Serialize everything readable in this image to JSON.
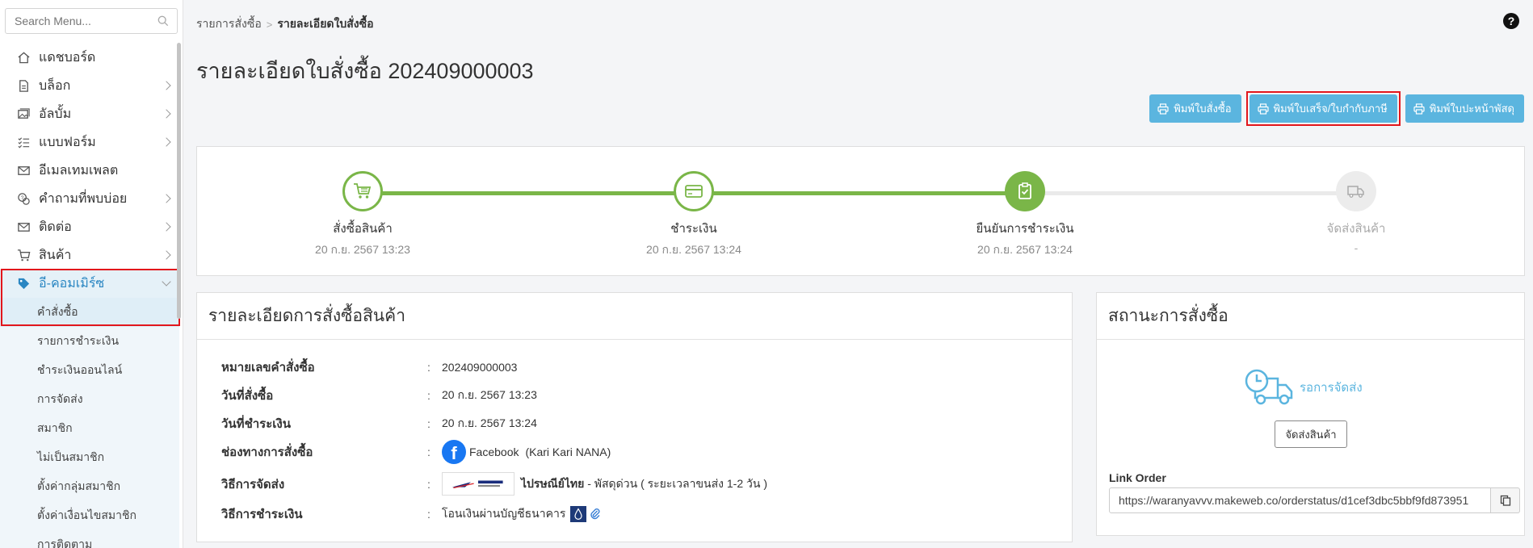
{
  "sidebar": {
    "search_placeholder": "Search Menu...",
    "items": [
      {
        "label": "แดชบอร์ด",
        "icon": "home-icon"
      },
      {
        "label": "บล็อก",
        "icon": "document-icon"
      },
      {
        "label": "อัลบั้ม",
        "icon": "album-icon"
      },
      {
        "label": "แบบฟอร์ม",
        "icon": "form-list-icon"
      },
      {
        "label": "อีเมลเทมเพลต",
        "icon": "envelope-icon"
      },
      {
        "label": "คำถามที่พบบ่อย",
        "icon": "faq-icon"
      },
      {
        "label": "ติดต่อ",
        "icon": "envelope-icon"
      },
      {
        "label": "สินค้า",
        "icon": "cart-icon"
      },
      {
        "label": "อี-คอมเมิร์ซ",
        "icon": "tag-icon"
      }
    ],
    "submenu": [
      "คำสั่งซื้อ",
      "รายการชำระเงิน",
      "ชำระเงินออนไลน์",
      "การจัดส่ง",
      "สมาชิก",
      "ไม่เป็นสมาชิก",
      "ตั้งค่ากลุ่มสมาชิก",
      "ตั้งค่าเงื่อนไขสมาชิก",
      "การติดตาม"
    ]
  },
  "breadcrumb": {
    "parent": "รายการสั่งซื้อ",
    "current": "รายละเอียดใบสั่งซื้อ"
  },
  "page_title": "รายละเอียดใบสั่งซื้อ 202409000003",
  "buttons": {
    "print_order": "พิมพ์ใบสั่งซื้อ",
    "print_receipt": "พิมพ์ใบเสร็จ/ใบกำกับภาษี",
    "print_label": "พิมพ์ใบปะหน้าพัสดุ"
  },
  "progress": {
    "steps": [
      {
        "label": "สั่งซื้อสินค้า",
        "date": "20 ก.ย. 2567 13:23",
        "state": "done"
      },
      {
        "label": "ชำระเงิน",
        "date": "20 ก.ย. 2567 13:24",
        "state": "done"
      },
      {
        "label": "ยืนยันการชำระเงิน",
        "date": "20 ก.ย. 2567 13:24",
        "state": "current"
      },
      {
        "label": "จัดส่งสินค้า",
        "date": "-",
        "state": "pending"
      }
    ]
  },
  "details": {
    "title": "รายละเอียดการสั่งซื้อสินค้า",
    "order_no_label": "หมายเลขคำสั่งซื้อ",
    "order_no": "202409000003",
    "order_date_label": "วันที่สั่งซื้อ",
    "order_date": "20 ก.ย. 2567 13:23",
    "pay_date_label": "วันที่ชำระเงิน",
    "pay_date": "20 ก.ย. 2567 13:24",
    "channel_label": "ช่องทางการสั่งซื้อ",
    "channel": "Facebook",
    "channel_account": "(Kari Kari NANA)",
    "shipping_label": "วิธีการจัดส่ง",
    "shipping_carrier": "ไปรษณีย์ไทย",
    "shipping_detail": " - พัสดุด่วน ( ระยะเวลาขนส่ง 1-2 วัน )",
    "payment_label": "วิธีการชำระเงิน",
    "payment": "โอนเงินผ่านบัญชีธนาคาร",
    "colon": ":"
  },
  "status": {
    "title": "สถานะการสั่งซื้อ",
    "state": "รอการจัดส่ง",
    "ship_button": "จัดส่งสินค้า",
    "link_label": "Link Order",
    "link_value": "https://waranyavvv.makeweb.co/orderstatus/d1cef3dbc5bbf9fd873951"
  },
  "colors": {
    "accent": "#5bb5df",
    "progress_green": "#7ab648",
    "highlight_red": "#e2161c"
  }
}
